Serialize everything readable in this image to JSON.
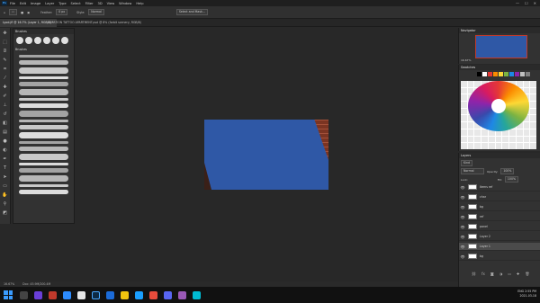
{
  "app": {
    "title": "Adobe Photoshop",
    "menu": [
      "File",
      "Edit",
      "Image",
      "Layer",
      "Type",
      "Select",
      "Filter",
      "3D",
      "View",
      "Window",
      "Help"
    ],
    "window_controls": [
      "—",
      "☐",
      "✕"
    ]
  },
  "options_bar": {
    "feather_label": "Feather:",
    "feather_value": "0 px",
    "style_label": "Style:",
    "style_value": "Normal",
    "select_mask_button": "Select and Mask..."
  },
  "doc_tabs": [
    {
      "label": "Lyod.jfl @ 16.7% (Layer 1, RGB/8) *",
      "active": true
    },
    {
      "label": "LOCATION TATTOO APARTMENT.psd @ 8% (forbit scenery, RGB/8)",
      "active": false
    }
  ],
  "brushes_panel": {
    "title": "Brushes",
    "preset_sizes": [
      "30",
      "30",
      "30",
      "25",
      "25",
      "60"
    ],
    "group_label": "Brushes",
    "stroke_count": 20
  },
  "canvas": {
    "wall_color": "#2f58a6",
    "brick_color": "#a3513a"
  },
  "navigator": {
    "title": "Navigator",
    "zoom": "16.67%"
  },
  "swatches": {
    "title": "Swatches",
    "colors": [
      "#000000",
      "#ffffff",
      "#e53935",
      "#fb8c00",
      "#fdd835",
      "#7cb342",
      "#1e88e5",
      "#8e24aa",
      "#c0c0c0",
      "#808080"
    ]
  },
  "layers_panel": {
    "title": "Layers",
    "kind_label": "Kind",
    "blend_mode": "Normal",
    "opacity_label": "Opacity:",
    "opacity_value": "100%",
    "lock_label": "Lock:",
    "fill_label": "Fill:",
    "fill_value": "100%",
    "layers": [
      {
        "name": "Items ref",
        "selected": false
      },
      {
        "name": "char",
        "selected": false
      },
      {
        "name": "bg",
        "selected": false
      },
      {
        "name": "ref",
        "selected": false
      },
      {
        "name": "panel",
        "selected": false
      },
      {
        "name": "Layer 2",
        "selected": false
      },
      {
        "name": "Layer 1",
        "selected": true
      },
      {
        "name": "bg",
        "selected": false
      }
    ]
  },
  "status_bar": {
    "zoom": "16.67%",
    "doc_size": "Doc: 45.9M/200.4M"
  },
  "taskbar": {
    "language": "ENG",
    "time": "2:55 PM",
    "date": "2021-03-18"
  }
}
